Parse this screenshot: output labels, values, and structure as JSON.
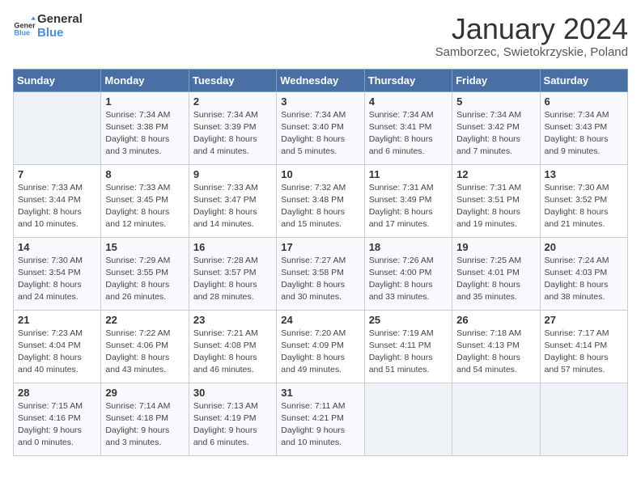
{
  "logo": {
    "line1": "General",
    "line2": "Blue"
  },
  "title": "January 2024",
  "subtitle": "Samborzec, Swietokrzyskie, Poland",
  "days_header": [
    "Sunday",
    "Monday",
    "Tuesday",
    "Wednesday",
    "Thursday",
    "Friday",
    "Saturday"
  ],
  "weeks": [
    [
      {
        "num": "",
        "info": ""
      },
      {
        "num": "1",
        "info": "Sunrise: 7:34 AM\nSunset: 3:38 PM\nDaylight: 8 hours\nand 3 minutes."
      },
      {
        "num": "2",
        "info": "Sunrise: 7:34 AM\nSunset: 3:39 PM\nDaylight: 8 hours\nand 4 minutes."
      },
      {
        "num": "3",
        "info": "Sunrise: 7:34 AM\nSunset: 3:40 PM\nDaylight: 8 hours\nand 5 minutes."
      },
      {
        "num": "4",
        "info": "Sunrise: 7:34 AM\nSunset: 3:41 PM\nDaylight: 8 hours\nand 6 minutes."
      },
      {
        "num": "5",
        "info": "Sunrise: 7:34 AM\nSunset: 3:42 PM\nDaylight: 8 hours\nand 7 minutes."
      },
      {
        "num": "6",
        "info": "Sunrise: 7:34 AM\nSunset: 3:43 PM\nDaylight: 8 hours\nand 9 minutes."
      }
    ],
    [
      {
        "num": "7",
        "info": "Sunrise: 7:33 AM\nSunset: 3:44 PM\nDaylight: 8 hours\nand 10 minutes."
      },
      {
        "num": "8",
        "info": "Sunrise: 7:33 AM\nSunset: 3:45 PM\nDaylight: 8 hours\nand 12 minutes."
      },
      {
        "num": "9",
        "info": "Sunrise: 7:33 AM\nSunset: 3:47 PM\nDaylight: 8 hours\nand 14 minutes."
      },
      {
        "num": "10",
        "info": "Sunrise: 7:32 AM\nSunset: 3:48 PM\nDaylight: 8 hours\nand 15 minutes."
      },
      {
        "num": "11",
        "info": "Sunrise: 7:31 AM\nSunset: 3:49 PM\nDaylight: 8 hours\nand 17 minutes."
      },
      {
        "num": "12",
        "info": "Sunrise: 7:31 AM\nSunset: 3:51 PM\nDaylight: 8 hours\nand 19 minutes."
      },
      {
        "num": "13",
        "info": "Sunrise: 7:30 AM\nSunset: 3:52 PM\nDaylight: 8 hours\nand 21 minutes."
      }
    ],
    [
      {
        "num": "14",
        "info": "Sunrise: 7:30 AM\nSunset: 3:54 PM\nDaylight: 8 hours\nand 24 minutes."
      },
      {
        "num": "15",
        "info": "Sunrise: 7:29 AM\nSunset: 3:55 PM\nDaylight: 8 hours\nand 26 minutes."
      },
      {
        "num": "16",
        "info": "Sunrise: 7:28 AM\nSunset: 3:57 PM\nDaylight: 8 hours\nand 28 minutes."
      },
      {
        "num": "17",
        "info": "Sunrise: 7:27 AM\nSunset: 3:58 PM\nDaylight: 8 hours\nand 30 minutes."
      },
      {
        "num": "18",
        "info": "Sunrise: 7:26 AM\nSunset: 4:00 PM\nDaylight: 8 hours\nand 33 minutes."
      },
      {
        "num": "19",
        "info": "Sunrise: 7:25 AM\nSunset: 4:01 PM\nDaylight: 8 hours\nand 35 minutes."
      },
      {
        "num": "20",
        "info": "Sunrise: 7:24 AM\nSunset: 4:03 PM\nDaylight: 8 hours\nand 38 minutes."
      }
    ],
    [
      {
        "num": "21",
        "info": "Sunrise: 7:23 AM\nSunset: 4:04 PM\nDaylight: 8 hours\nand 40 minutes."
      },
      {
        "num": "22",
        "info": "Sunrise: 7:22 AM\nSunset: 4:06 PM\nDaylight: 8 hours\nand 43 minutes."
      },
      {
        "num": "23",
        "info": "Sunrise: 7:21 AM\nSunset: 4:08 PM\nDaylight: 8 hours\nand 46 minutes."
      },
      {
        "num": "24",
        "info": "Sunrise: 7:20 AM\nSunset: 4:09 PM\nDaylight: 8 hours\nand 49 minutes."
      },
      {
        "num": "25",
        "info": "Sunrise: 7:19 AM\nSunset: 4:11 PM\nDaylight: 8 hours\nand 51 minutes."
      },
      {
        "num": "26",
        "info": "Sunrise: 7:18 AM\nSunset: 4:13 PM\nDaylight: 8 hours\nand 54 minutes."
      },
      {
        "num": "27",
        "info": "Sunrise: 7:17 AM\nSunset: 4:14 PM\nDaylight: 8 hours\nand 57 minutes."
      }
    ],
    [
      {
        "num": "28",
        "info": "Sunrise: 7:15 AM\nSunset: 4:16 PM\nDaylight: 9 hours\nand 0 minutes."
      },
      {
        "num": "29",
        "info": "Sunrise: 7:14 AM\nSunset: 4:18 PM\nDaylight: 9 hours\nand 3 minutes."
      },
      {
        "num": "30",
        "info": "Sunrise: 7:13 AM\nSunset: 4:19 PM\nDaylight: 9 hours\nand 6 minutes."
      },
      {
        "num": "31",
        "info": "Sunrise: 7:11 AM\nSunset: 4:21 PM\nDaylight: 9 hours\nand 10 minutes."
      },
      {
        "num": "",
        "info": ""
      },
      {
        "num": "",
        "info": ""
      },
      {
        "num": "",
        "info": ""
      }
    ]
  ]
}
